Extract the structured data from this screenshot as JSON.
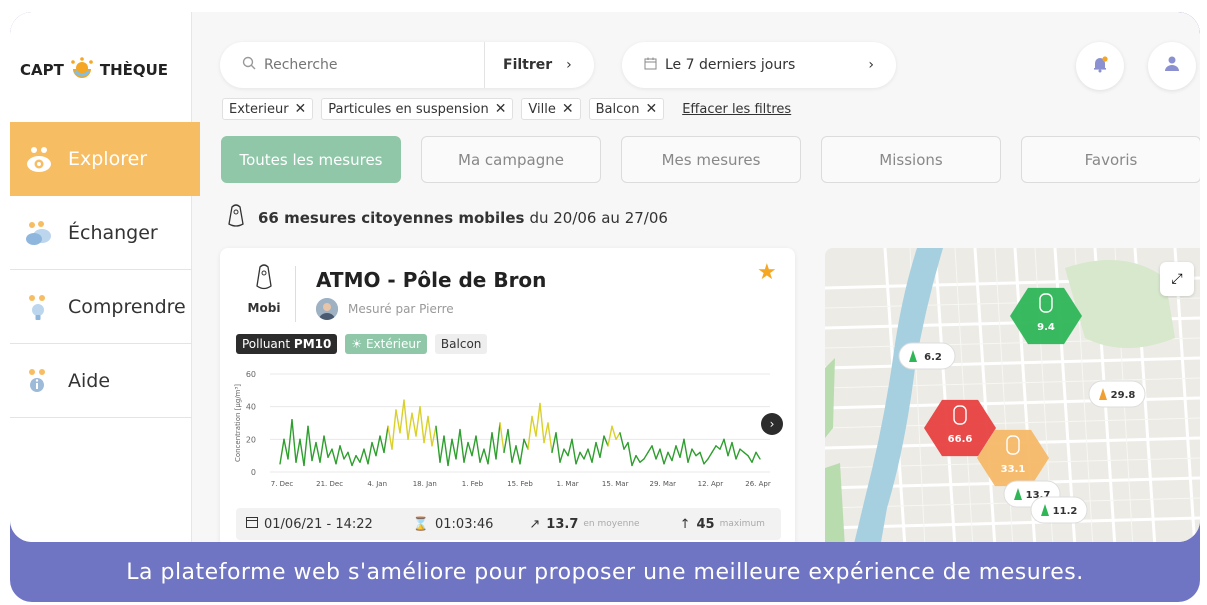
{
  "logo": {
    "left": "CAPT",
    "right": "THÈQUE"
  },
  "sidebar": {
    "items": [
      {
        "label": "Explorer",
        "icon": "binoculars-icon",
        "active": true
      },
      {
        "label": "Échanger",
        "icon": "chat-icon",
        "active": false
      },
      {
        "label": "Comprendre",
        "icon": "bulb-icon",
        "active": false
      },
      {
        "label": "Aide",
        "icon": "info-icon",
        "active": false
      }
    ]
  },
  "search": {
    "placeholder": "Recherche",
    "filter_label": "Filtrer"
  },
  "date_range": {
    "label": "Le 7 derniers jours"
  },
  "filters": {
    "chips": [
      "Exterieur",
      "Particules en suspension",
      "Ville",
      "Balcon"
    ],
    "clear_label": "Effacer les filtres"
  },
  "tabs": [
    "Toutes les mesures",
    "Ma campagne",
    "Mes mesures",
    "Missions",
    "Favoris"
  ],
  "summary": {
    "count_label": "66 mesures citoyennes mobiles",
    "period": "du 20/06 au 27/06"
  },
  "card": {
    "device": "Mobi",
    "title": "ATMO - Pôle de Bron",
    "author": "Mesuré par Pierre",
    "tag_pollutant_prefix": "Polluant",
    "tag_pollutant": "PM10",
    "tag_env": "Extérieur",
    "tag_place": "Balcon",
    "stats": {
      "date": "01/06/21 - 14:22",
      "duration": "01:03:46",
      "average": "13.7",
      "average_label": "en moyenne",
      "max": "45",
      "max_label": "maximum"
    }
  },
  "chart_data": {
    "type": "line",
    "ylabel": "Concentration [µg/m³]",
    "ylim": [
      0,
      60
    ],
    "yticks": [
      0,
      20,
      40,
      60
    ],
    "xticks": [
      "7. Dec",
      "21. Dec",
      "4. Jan",
      "18. Jan",
      "1. Feb",
      "15. Feb",
      "1. Mar",
      "15. Mar",
      "29. Mar",
      "12. Apr",
      "26. Apr"
    ],
    "threshold": 20,
    "colors": {
      "below": "#2e9e2e",
      "above": "#d9d02a"
    },
    "series": [
      {
        "values": [
          5,
          20,
          8,
          32,
          6,
          20,
          4,
          28,
          7,
          18,
          6,
          22,
          9,
          14,
          5,
          16,
          8,
          12,
          4,
          10,
          6,
          14,
          5,
          18,
          10,
          22,
          12,
          28,
          14,
          38,
          24,
          44,
          20,
          36,
          22,
          40,
          18,
          34,
          16,
          28,
          6,
          22,
          4,
          20,
          8,
          26,
          6,
          18,
          10,
          22,
          6,
          14,
          5,
          24,
          8,
          30,
          12,
          26,
          6,
          16,
          5,
          20,
          14,
          34,
          22,
          42,
          18,
          30,
          12,
          24,
          6,
          14,
          10,
          20,
          5,
          12,
          8,
          14,
          6,
          18,
          9,
          22,
          16,
          28,
          20,
          24,
          14,
          18,
          4,
          10,
          6,
          8,
          12,
          16,
          8,
          14,
          5,
          12,
          7,
          16,
          9,
          20,
          6,
          14,
          10,
          12,
          5,
          8,
          12,
          16,
          14,
          20,
          10,
          18,
          8,
          14,
          12,
          10,
          6,
          12,
          8
        ]
      }
    ]
  },
  "map": {
    "markers": [
      {
        "value": "9.4",
        "color": "#2fb657",
        "kind": "hex"
      },
      {
        "value": "66.6",
        "color": "#e84040",
        "kind": "hex"
      },
      {
        "value": "33.1",
        "color": "#f6b867",
        "kind": "hex"
      },
      {
        "value": "6.2",
        "color": "#2fb657",
        "kind": "pin"
      },
      {
        "value": "29.8",
        "color": "#f0a030",
        "kind": "pin"
      },
      {
        "value": "13.7",
        "color": "#2fb657",
        "kind": "pin"
      },
      {
        "value": "11.2",
        "color": "#2fb657",
        "kind": "pin"
      }
    ]
  },
  "caption": "La plateforme web s'améliore pour proposer une meilleure expérience de mesures."
}
